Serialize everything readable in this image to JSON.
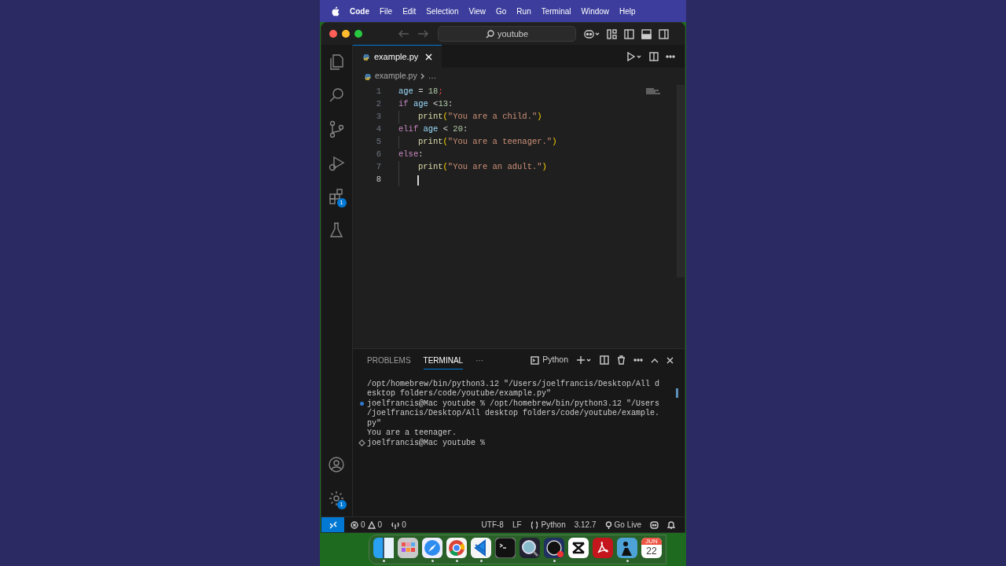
{
  "menubar": {
    "app": "Code",
    "items": [
      "File",
      "Edit",
      "Selection",
      "View",
      "Go",
      "Run",
      "Terminal",
      "Window",
      "Help"
    ]
  },
  "titlebar": {
    "search": "youtube"
  },
  "activity_bar": [
    {
      "kind": "files"
    },
    {
      "kind": "search"
    },
    {
      "kind": "scm"
    },
    {
      "kind": "run"
    },
    {
      "kind": "extensions",
      "badge": "1"
    },
    {
      "kind": "testing"
    }
  ],
  "activity_bottom": [
    {
      "kind": "account"
    },
    {
      "kind": "settings",
      "badge": "1"
    }
  ],
  "tabs": [
    {
      "label": "example.py",
      "selected": true
    }
  ],
  "breadcrumb": {
    "file": "example.py",
    "rest": "…"
  },
  "code": [
    {
      "number": "1",
      "current": false,
      "tokens": [
        {
          "kind": "var",
          "text": "age"
        },
        {
          "kind": "plain",
          "text": " = "
        },
        {
          "kind": "num",
          "text": "18"
        },
        {
          "kind": "error",
          "text": ";"
        }
      ]
    },
    {
      "number": "2",
      "current": false,
      "tokens": [
        {
          "kind": "keyword",
          "text": "if "
        },
        {
          "kind": "var",
          "text": "age"
        },
        {
          "kind": "plain",
          "text": " <"
        },
        {
          "kind": "num",
          "text": "13"
        },
        {
          "kind": "plain",
          "text": ":"
        }
      ],
      "children": [
        {
          "number": "3",
          "current": false,
          "tokens": [
            {
              "kind": "func",
              "text": "print"
            },
            {
              "kind": "paren",
              "text": "("
            },
            {
              "kind": "str",
              "text": "\"You are a child.\""
            },
            {
              "kind": "paren",
              "text": ")"
            }
          ]
        }
      ]
    },
    {
      "number": "4",
      "current": false,
      "tokens": [
        {
          "kind": "keyword",
          "text": "elif "
        },
        {
          "kind": "var",
          "text": "age"
        },
        {
          "kind": "plain",
          "text": " < "
        },
        {
          "kind": "num",
          "text": "20"
        },
        {
          "kind": "plain",
          "text": ":"
        }
      ],
      "children": [
        {
          "number": "5",
          "current": false,
          "tokens": [
            {
              "kind": "func",
              "text": "print"
            },
            {
              "kind": "paren",
              "text": "("
            },
            {
              "kind": "str",
              "text": "\"You are a teenager.\""
            },
            {
              "kind": "paren",
              "text": ")"
            }
          ]
        }
      ]
    },
    {
      "number": "6",
      "current": false,
      "tokens": [
        {
          "kind": "keyword",
          "text": "else"
        },
        {
          "kind": "plain",
          "text": ":"
        }
      ],
      "children": [
        {
          "number": "7",
          "current": false,
          "tokens": [
            {
              "kind": "func",
              "text": "print"
            },
            {
              "kind": "paren",
              "text": "("
            },
            {
              "kind": "str",
              "text": "\"You are an adult.\""
            },
            {
              "kind": "paren",
              "text": ")"
            }
          ]
        },
        {
          "number": "8",
          "current": true
        }
      ]
    }
  ],
  "panel": {
    "tabs": [
      {
        "label": "PROBLEMS",
        "selected": false
      },
      {
        "label": "TERMINAL",
        "selected": true
      },
      {
        "label": "···",
        "selected": false
      }
    ],
    "shell": "Python"
  },
  "terminal": [
    {
      "kind": "output",
      "text": "/opt/homebrew/bin/python3.12 \"/Users/joelfrancis/Desktop/All d"
    },
    {
      "kind": "output",
      "text": "esktop folders/code/youtube/example.py\""
    },
    {
      "kind": "success",
      "text": "joelfrancis@Mac youtube % /opt/homebrew/bin/python3.12 \"/Users"
    },
    {
      "kind": "output",
      "text": "/joelfrancis/Desktop/All desktop folders/code/youtube/example."
    },
    {
      "kind": "output",
      "text": "py\""
    },
    {
      "kind": "output",
      "text": "You are a teenager."
    },
    {
      "kind": "prompt",
      "text": "joelfrancis@Mac youtube %"
    }
  ],
  "status_bar": {
    "errors": "0",
    "warnings": "0",
    "ports": "0",
    "encoding": "UTF-8",
    "eol": "LF",
    "language": "Python",
    "version": "3.12.7",
    "live": "Go Live"
  },
  "dock": [
    {
      "kind": "finder",
      "running": true
    },
    {
      "kind": "launchpad",
      "running": false
    },
    {
      "kind": "safari",
      "running": true
    },
    {
      "kind": "chrome",
      "running": true
    },
    {
      "kind": "vscode",
      "running": true
    },
    {
      "kind": "terminal",
      "running": false
    },
    {
      "kind": "quicktime",
      "running": false
    },
    {
      "kind": "obs",
      "running": true
    },
    {
      "kind": "capcut",
      "running": false
    },
    {
      "kind": "acrobat",
      "running": false
    },
    {
      "kind": "kindle",
      "running": true
    },
    {
      "kind": "calendar",
      "running": false,
      "month": "JUN",
      "day": "22"
    }
  ]
}
